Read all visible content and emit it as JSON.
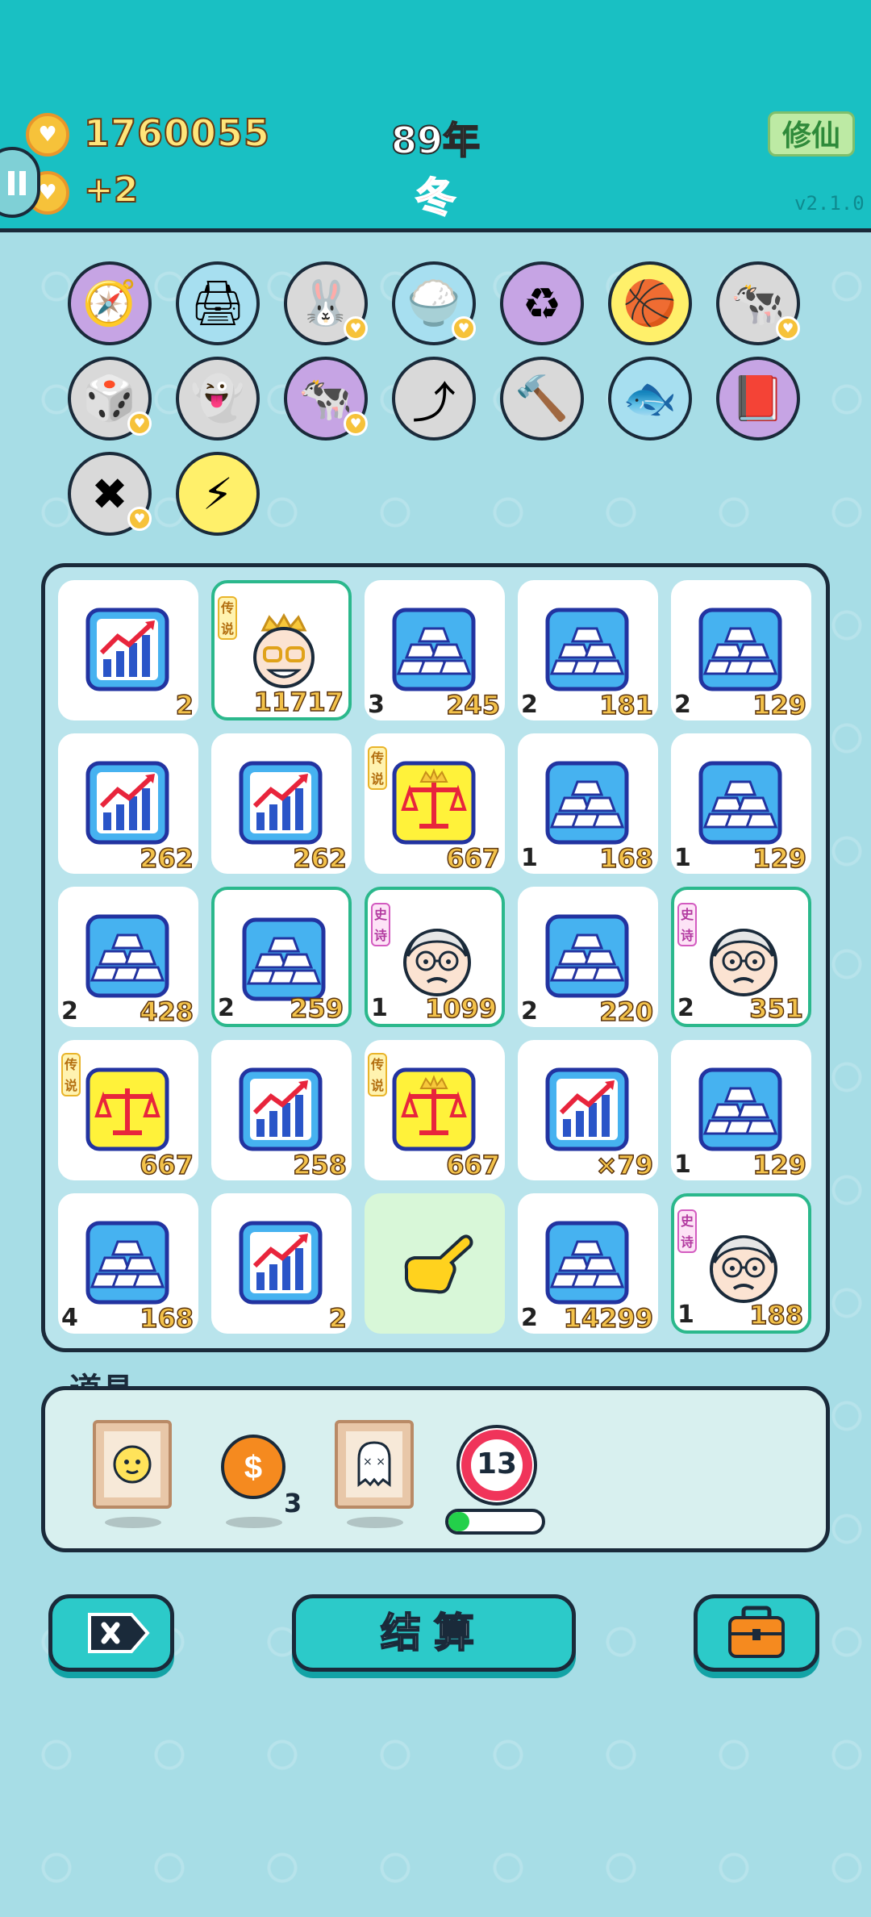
{
  "header": {
    "money": "1760055",
    "income": "+2",
    "year": "89年",
    "season": "冬",
    "mode_button": "修仙",
    "version": "v2.1.0"
  },
  "owned_symbols": [
    {
      "icon": "compass-icon",
      "glyph": "🧭",
      "bg": "#c6a4e4"
    },
    {
      "icon": "printer-icon",
      "glyph": "🖨",
      "bg": "#a7dff0"
    },
    {
      "icon": "rabbit-icon",
      "glyph": "🐰",
      "bg": "#d9d9d9"
    },
    {
      "icon": "rice-bowl-icon",
      "glyph": "🍚",
      "bg": "#a7dff0"
    },
    {
      "icon": "recycle-icon",
      "glyph": "♻",
      "bg": "#c6a4e4"
    },
    {
      "icon": "basketballs-icon",
      "glyph": "🏀",
      "bg": "#fff06a"
    },
    {
      "icon": "cows-icon",
      "glyph": "🐄",
      "bg": "#d9d9d9"
    },
    {
      "icon": "dice-icon",
      "glyph": "🎲",
      "bg": "#d9d9d9"
    },
    {
      "icon": "ghost-icon",
      "glyph": "👻",
      "bg": "#d9d9d9"
    },
    {
      "icon": "cows-icon",
      "glyph": "🐄",
      "bg": "#c6a4e4"
    },
    {
      "icon": "arrow-card-icon",
      "glyph": "⤴",
      "bg": "#d9d9d9"
    },
    {
      "icon": "hammer-icon",
      "glyph": "🔨",
      "bg": "#d9d9d9"
    },
    {
      "icon": "fishbowl-icon",
      "glyph": "🐟",
      "bg": "#a7dff0"
    },
    {
      "icon": "time-magazine-icon",
      "glyph": "📕",
      "bg": "#c6a4e4"
    },
    {
      "icon": "remove-tag-icon",
      "glyph": "✖",
      "bg": "#d9d9d9"
    },
    {
      "icon": "lightning-icon",
      "glyph": "⚡",
      "bg": "#fff06a"
    }
  ],
  "grid": [
    [
      {
        "type": "chart",
        "count": "",
        "value": "2",
        "tag": "",
        "hl": false
      },
      {
        "type": "king",
        "count": "",
        "value": "11717",
        "tag": "传说",
        "hl": true
      },
      {
        "type": "gold",
        "count": "3",
        "value": "245",
        "tag": "",
        "hl": false
      },
      {
        "type": "gold",
        "count": "2",
        "value": "181",
        "tag": "",
        "hl": false
      },
      {
        "type": "gold",
        "count": "2",
        "value": "129",
        "tag": "",
        "hl": false
      }
    ],
    [
      {
        "type": "chart",
        "count": "",
        "value": "262",
        "tag": "",
        "hl": false
      },
      {
        "type": "chart",
        "count": "",
        "value": "262",
        "tag": "",
        "hl": false
      },
      {
        "type": "scale-crown",
        "count": "",
        "value": "667",
        "tag": "传说",
        "hl": false
      },
      {
        "type": "gold",
        "count": "1",
        "value": "168",
        "tag": "",
        "hl": false
      },
      {
        "type": "gold",
        "count": "1",
        "value": "129",
        "tag": "",
        "hl": false
      }
    ],
    [
      {
        "type": "gold",
        "count": "2",
        "value": "428",
        "tag": "",
        "hl": false
      },
      {
        "type": "gold",
        "count": "2",
        "value": "259",
        "tag": "",
        "hl": true
      },
      {
        "type": "grandpa",
        "count": "1",
        "value": "1099",
        "tag": "史诗",
        "hl": true
      },
      {
        "type": "gold",
        "count": "2",
        "value": "220",
        "tag": "",
        "hl": false
      },
      {
        "type": "grandpa",
        "count": "2",
        "value": "351",
        "tag": "史诗",
        "hl": true
      }
    ],
    [
      {
        "type": "scale",
        "count": "",
        "value": "667",
        "tag": "传说",
        "hl": false
      },
      {
        "type": "chart",
        "count": "",
        "value": "258",
        "tag": "",
        "hl": false
      },
      {
        "type": "scale-crown",
        "count": "",
        "value": "667",
        "tag": "传说",
        "hl": false
      },
      {
        "type": "chart",
        "count": "",
        "value": "×79",
        "tag": "",
        "hl": false
      },
      {
        "type": "gold",
        "count": "1",
        "value": "129",
        "tag": "",
        "hl": false
      }
    ],
    [
      {
        "type": "gold",
        "count": "4",
        "value": "168",
        "tag": "",
        "hl": false
      },
      {
        "type": "chart",
        "count": "",
        "value": "2",
        "tag": "",
        "hl": false
      },
      {
        "type": "pointer",
        "count": "",
        "value": "",
        "tag": "",
        "hl": false,
        "target": true
      },
      {
        "type": "gold",
        "count": "2",
        "value": "14299",
        "tag": "",
        "hl": false
      },
      {
        "type": "grandpa",
        "count": "1",
        "value": "188",
        "tag": "史诗",
        "hl": true
      }
    ]
  ],
  "props": {
    "title": "道具",
    "coin_count": "3",
    "timer_value": "13",
    "timer_progress": 0.22
  },
  "buttons": {
    "settle_label": "结算"
  }
}
